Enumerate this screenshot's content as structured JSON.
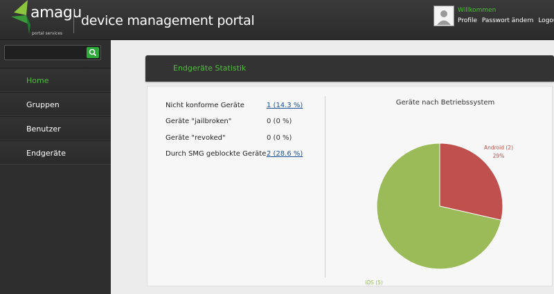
{
  "header": {
    "brand": "amagu",
    "brand_sub": "portal services",
    "title": "device management portal",
    "welcome": "Willkommen",
    "links": [
      "Profile",
      "Passwort ändern",
      "Logout"
    ]
  },
  "sidebar": {
    "search": {
      "value": "",
      "placeholder": ""
    },
    "items": [
      {
        "label": "Home",
        "active": true
      },
      {
        "label": "Gruppen"
      },
      {
        "label": "Benutzer"
      },
      {
        "label": "Endgeräte"
      }
    ]
  },
  "panel": {
    "title": "Endgeräte Statistik",
    "stats": [
      {
        "label": "Nicht konforme Geräte",
        "value": "1 (14.3 %)"
      },
      {
        "label": "Geräte \"jailbroken\"",
        "value": "0 (0 %)"
      },
      {
        "label": "Geräte \"revoked\"",
        "value": "0 (0 %)"
      },
      {
        "label": "Durch SMG geblockte Geräte",
        "value": "2 (28.6 %)"
      }
    ]
  },
  "chart_data": {
    "type": "pie",
    "title": "Geräte nach Betriebssystem",
    "slices": [
      {
        "label": "Android (2)",
        "value": 2,
        "percent": "29%",
        "color": "#c0504d"
      },
      {
        "label": "iOS (5)",
        "value": 5,
        "percent": "71%",
        "color": "#9bbb59"
      }
    ]
  },
  "colors": {
    "accent": "#4fbf3a",
    "link": "#1a4f9a"
  }
}
